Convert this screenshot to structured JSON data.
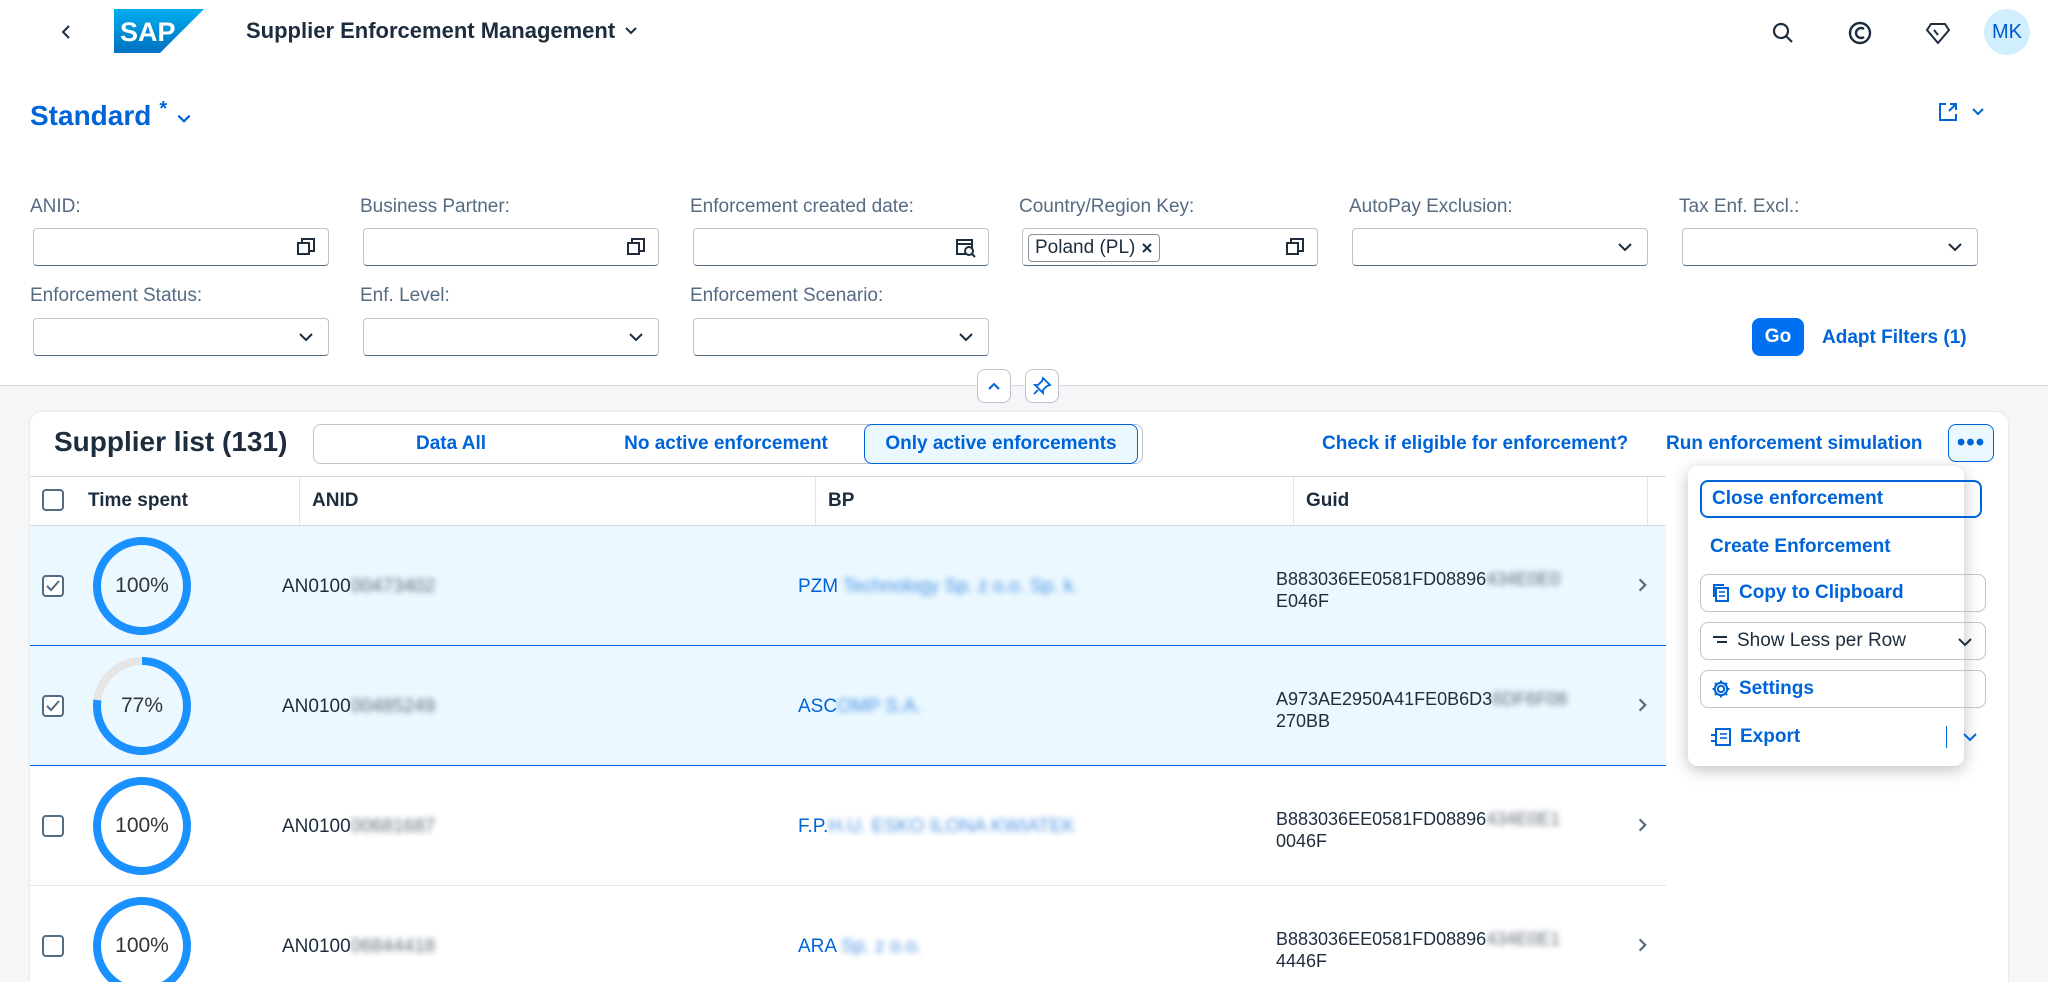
{
  "shell": {
    "app_title": "Supplier Enforcement Management",
    "user_initials": "MK",
    "logo_text": "SAP"
  },
  "variant": {
    "name": "Standard",
    "modified_marker": "*"
  },
  "filters": {
    "anid_label": "ANID:",
    "bp_label": "Business Partner:",
    "created_date_label": "Enforcement created date:",
    "country_label": "Country/Region Key:",
    "country_token": "Poland (PL)",
    "autopay_label": "AutoPay Exclusion:",
    "tax_label": "Tax Enf. Excl.:",
    "status_label": "Enforcement Status:",
    "level_label": "Enf. Level:",
    "scenario_label": "Enforcement Scenario:",
    "go_label": "Go",
    "adapt_label": "Adapt Filters (1)"
  },
  "table": {
    "title": "Supplier list (131)",
    "segments": [
      "Data All",
      "No active enforcement",
      "Only active enforcements"
    ],
    "active_segment": "Only active enforcements",
    "check_link": "Check if eligible for enforcement?",
    "simulate_link": "Run enforcement simulation",
    "columns": [
      "Time spent",
      "ANID",
      "BP",
      "Guid"
    ],
    "rows": [
      {
        "selected": true,
        "progress": 100,
        "progress_label": "100%",
        "anid_visible": "AN0100",
        "anid_hidden": "00473402",
        "bp_visible": "PZM",
        "bp_hidden": " Technology  Sp. z o.o. Sp. k.",
        "guid_line1_visible": "B883036EE0581FD08896",
        "guid_line1_hidden": "434E0E0",
        "guid_line2": "E046F"
      },
      {
        "selected": true,
        "progress": 77,
        "progress_label": "77%",
        "anid_visible": "AN0100",
        "anid_hidden": "00485249",
        "bp_visible": "ASC",
        "bp_hidden": "OMP S.A.",
        "guid_line1_visible": "A973AE2950A41FE0B6D3",
        "guid_line1_hidden": "6DF6F08",
        "guid_line2": "270BB"
      },
      {
        "selected": false,
        "progress": 100,
        "progress_label": "100%",
        "anid_visible": "AN0100",
        "anid_hidden": "00681687",
        "bp_visible": "F.P.",
        "bp_hidden": "H.U. ESKO ILONA KWIATEK",
        "guid_line1_visible": "B883036EE0581FD08896",
        "guid_line1_hidden": "434E0E1",
        "guid_line2": "0046F"
      },
      {
        "selected": false,
        "progress": 100,
        "progress_label": "100%",
        "anid_visible": "AN0100",
        "anid_hidden": "06844418",
        "bp_visible": "ARA",
        "bp_hidden": " Sp. z o.o.",
        "guid_line1_visible": "B883036EE0581FD08896",
        "guid_line1_hidden": "434E0E1",
        "guid_line2": "4446F"
      }
    ]
  },
  "menu": {
    "close": "Close enforcement",
    "create": "Create Enforcement",
    "copy": "Copy to Clipboard",
    "show_less": "Show Less per Row",
    "settings": "Settings",
    "export": "Export"
  },
  "colors": {
    "accent": "#0064d9",
    "progress": "#1b90ff",
    "progress_track": "#e5e5e5",
    "selected_row": "#ebf8ff"
  }
}
